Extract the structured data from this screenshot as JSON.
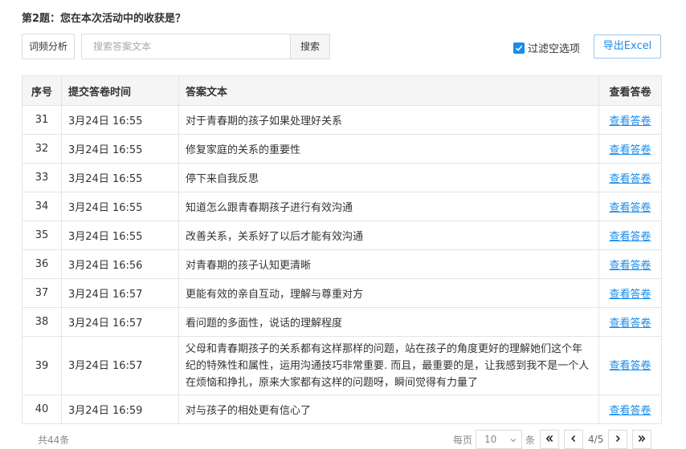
{
  "question": {
    "title": "第2题：您在本次活动中的收获是？"
  },
  "toolbar": {
    "freq_label": "词频分析",
    "search_placeholder": "搜索答案文本",
    "search_value": "",
    "search_label": "搜索",
    "filter_label": "过滤空选项",
    "filter_checked": true,
    "export_label": "导出Excel"
  },
  "table": {
    "headers": [
      "序号",
      "提交答卷时间",
      "答案文本",
      "查看答卷"
    ],
    "rows": [
      {
        "no": "31",
        "time": "3月24日 16:55",
        "text": "对于青春期的孩子如果处理好关系",
        "link": "查看答卷"
      },
      {
        "no": "32",
        "time": "3月24日 16:55",
        "text": "修复家庭的关系的重要性",
        "link": "查看答卷"
      },
      {
        "no": "33",
        "time": "3月24日 16:55",
        "text": "停下来自我反思",
        "link": "查看答卷"
      },
      {
        "no": "34",
        "time": "3月24日 16:55",
        "text": "知道怎么跟青春期孩子进行有效沟通",
        "link": "查看答卷"
      },
      {
        "no": "35",
        "time": "3月24日 16:55",
        "text": "改善关系，关系好了以后才能有效沟通",
        "link": "查看答卷"
      },
      {
        "no": "36",
        "time": "3月24日 16:56",
        "text": "对青春期的孩子认知更清晰",
        "link": "查看答卷"
      },
      {
        "no": "37",
        "time": "3月24日 16:57",
        "text": "更能有效的亲自互动，理解与尊重对方",
        "link": "查看答卷"
      },
      {
        "no": "38",
        "time": "3月24日 16:57",
        "text": "看问题的多面性，说话的理解程度",
        "link": "查看答卷"
      },
      {
        "no": "39",
        "time": "3月24日 16:57",
        "text": "父母和青春期孩子的关系都有这样那样的问题，站在孩子的角度更好的理解她们这个年纪的特殊性和属性，运用沟通技巧非常重要. 而且，最重要的是，让我感到我不是一个人在烦恼和挣扎，原来大家都有这样的问题呀，瞬间觉得有力量了",
        "link": "查看答卷"
      },
      {
        "no": "40",
        "time": "3月24日 16:59",
        "text": "对与孩子的相处更有信心了",
        "link": "查看答卷"
      }
    ]
  },
  "footer": {
    "total": "共44条",
    "per_page_label": "每页",
    "per_page_value": "10",
    "unit_label": "条",
    "page_info": "4/5"
  },
  "colors": {
    "accent": "#1a8ceb",
    "header_bg": "#f5f5f5",
    "border": "#e4e4e4"
  }
}
